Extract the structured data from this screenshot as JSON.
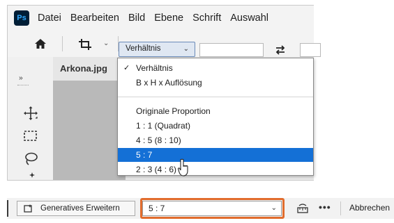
{
  "app": {
    "logo": "Ps"
  },
  "menubar": {
    "items": [
      "Datei",
      "Bearbeiten",
      "Bild",
      "Ebene",
      "Schrift",
      "Auswahl"
    ]
  },
  "options_bar": {
    "home_icon": "home-icon",
    "crop_tool_icon": "crop-icon",
    "ratio_select_value": "Verhältnis",
    "swap_icon": "swap-arrows-icon"
  },
  "document_tab": {
    "title": "Arkona.jpg"
  },
  "tools": [
    "move-icon",
    "rect-marquee-icon",
    "lasso-icon",
    "magic-wand-icon"
  ],
  "ratio_dropdown": {
    "items": [
      {
        "label": "Verhältnis",
        "checked": true,
        "selected": false
      },
      {
        "label": "B x H x Auflösung",
        "checked": false,
        "selected": false
      },
      {
        "label": "Originale Proportion",
        "checked": false,
        "selected": false
      },
      {
        "label": "1 : 1 (Quadrat)",
        "checked": false,
        "selected": false
      },
      {
        "label": "4 : 5 (8 : 10)",
        "checked": false,
        "selected": false
      },
      {
        "label": "5 : 7",
        "checked": false,
        "selected": true
      },
      {
        "label": "2 : 3 (4 : 6)",
        "checked": false,
        "selected": false
      }
    ],
    "check_mark": "✓"
  },
  "contextual_bar": {
    "generative_button": "Generatives Erweitern",
    "ratio_value": "5 : 7",
    "more_label": "•••",
    "cancel_label": "Abbrechen",
    "highlight_color": "#e16c2d"
  },
  "colors": {
    "selection": "#1470d6",
    "ps_dark": "#001e36",
    "ps_blue": "#31a8ff"
  }
}
